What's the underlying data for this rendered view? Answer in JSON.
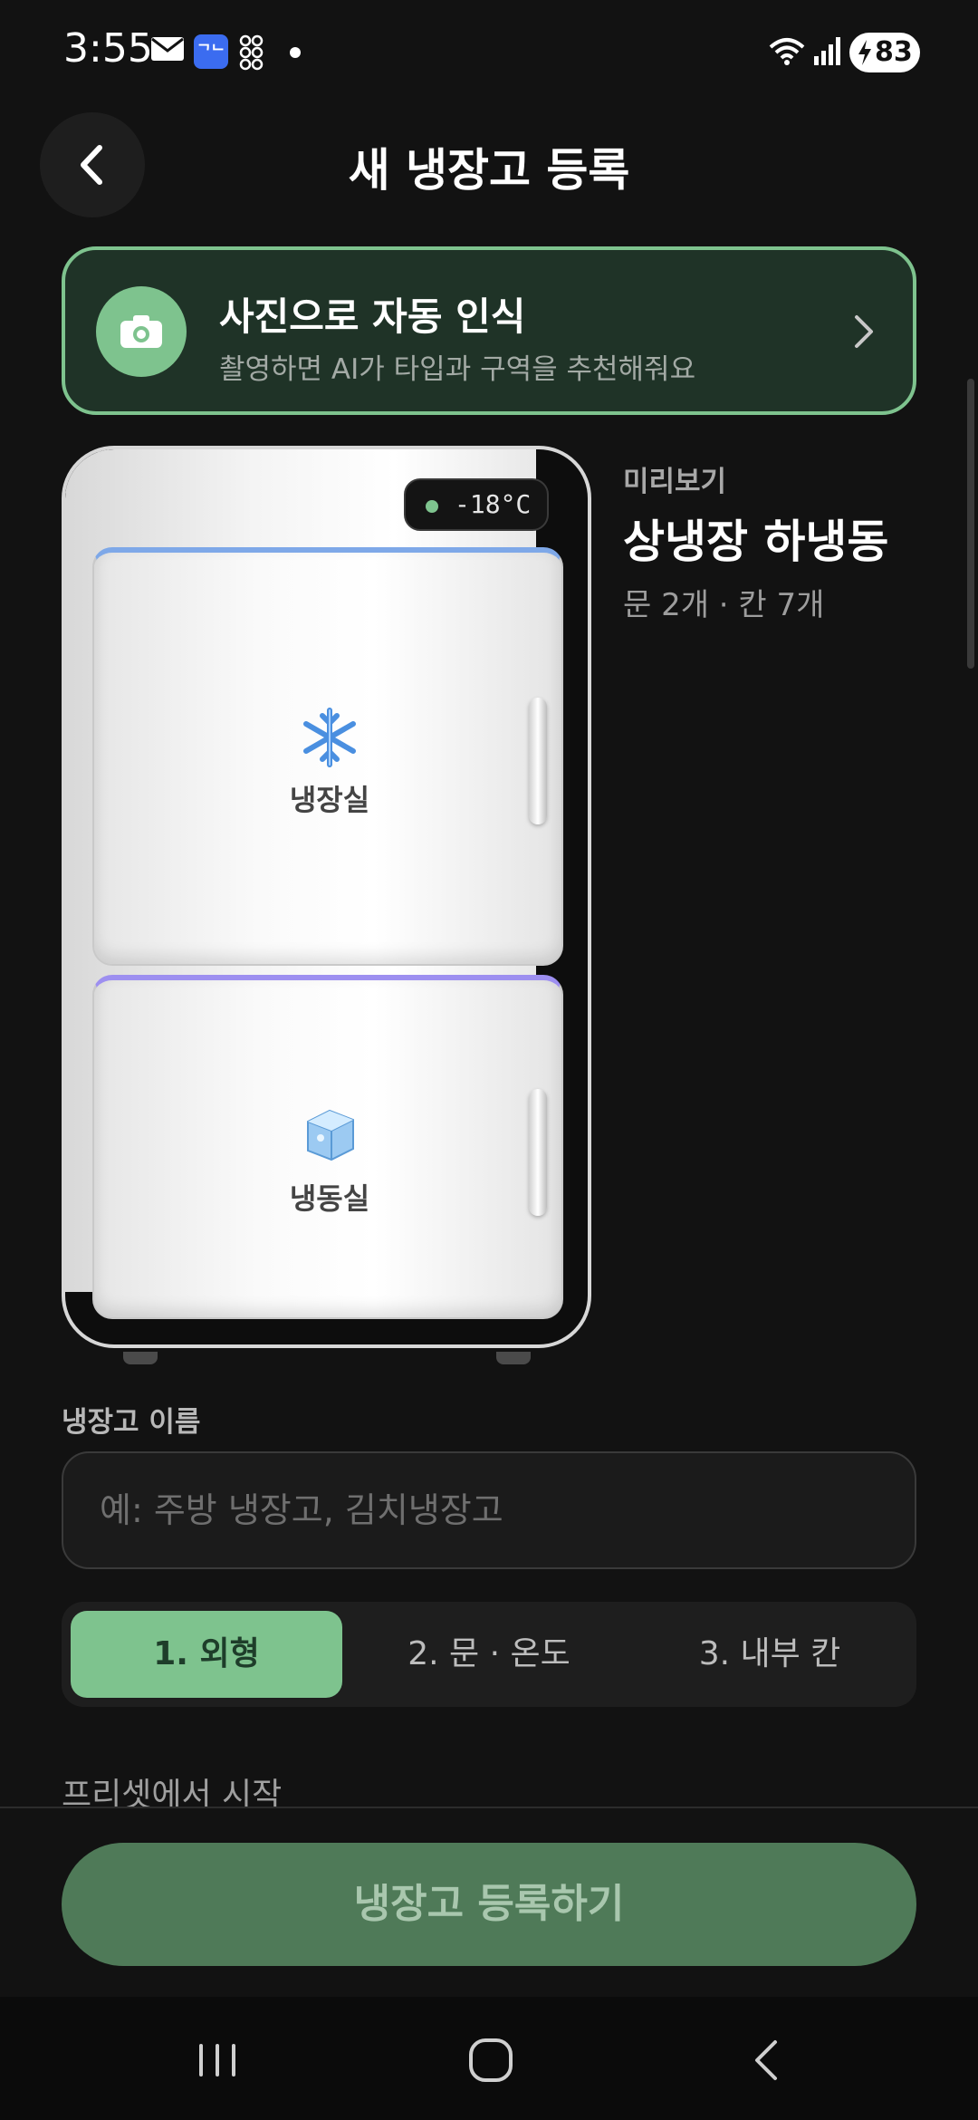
{
  "status_bar": {
    "time": "3:55",
    "app_badge": "ᄀᄂ",
    "battery": "83"
  },
  "header": {
    "title": "새 냉장고 등록",
    "back_icon": "chevron-left-icon"
  },
  "photo_card": {
    "title": "사진으로 자동 인식",
    "subtitle": "촬영하면 AI가 타입과 구역을 추천해줘요",
    "icon": "camera-icon"
  },
  "fridge_preview": {
    "temperature": "-18°C",
    "top_compartment": {
      "label": "냉장실",
      "icon": "snowflake-icon"
    },
    "bottom_compartment": {
      "label": "냉동실",
      "icon": "ice-cube-icon"
    }
  },
  "preview_info": {
    "caption": "미리보기",
    "type": "상냉장 하냉동",
    "meta": "문 2개 · 칸 7개"
  },
  "name_field": {
    "label": "냉장고 이름",
    "placeholder": "예: 주방 냉장고, 김치냉장고",
    "value": ""
  },
  "steps": [
    {
      "label": "1. 외형",
      "active": true
    },
    {
      "label": "2. 문 · 온도",
      "active": false
    },
    {
      "label": "3. 내부 칸",
      "active": false
    }
  ],
  "preset_label": "프리셋에서 시작",
  "register_button": "냉장고 등록하기",
  "colors": {
    "accent": "#7ec38e",
    "background": "#121212",
    "card_bg": "#1f3327",
    "button_disabled": "#4f7a58"
  }
}
